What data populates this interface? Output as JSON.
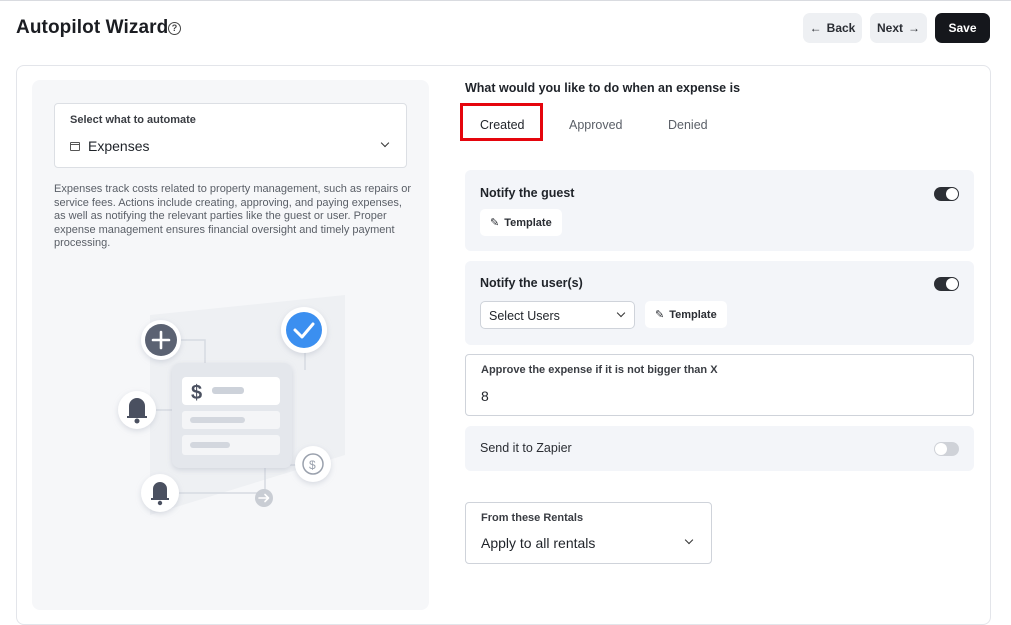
{
  "header": {
    "title": "Autopilot Wizard",
    "help_glyph": "?",
    "back_label": "Back",
    "next_label": "Next",
    "save_label": "Save"
  },
  "automate": {
    "label": "Select what to automate",
    "value": "Expenses",
    "description": "Expenses track costs related to property management, such as repairs or service fees. Actions include creating, approving, and paying expenses, as well as notifying the relevant parties like the guest or user. Proper expense management ensures financial oversight and timely payment processing."
  },
  "question": "What would you like to do when an expense is",
  "tabs": [
    {
      "label": "Created",
      "active": true
    },
    {
      "label": "Approved",
      "active": false
    },
    {
      "label": "Denied",
      "active": false
    }
  ],
  "notify_guest": {
    "title": "Notify the guest",
    "enabled": true,
    "template_label": "Template"
  },
  "notify_users": {
    "title": "Notify the user(s)",
    "enabled": true,
    "select_value": "Select Users",
    "template_label": "Template"
  },
  "approve": {
    "label": "Approve the expense if it is not bigger than X",
    "value": "8"
  },
  "zapier": {
    "label": "Send it to Zapier",
    "enabled": false
  },
  "rentals": {
    "label": "From these Rentals",
    "value": "Apply to all rentals"
  },
  "illustration": {
    "currency_glyph": "$",
    "coin_glyph": "$"
  },
  "colors": {
    "save_bg": "#15171c",
    "highlight": "#e5050d",
    "check_blue": "#3b8ff0",
    "panel_bg": "#f3f5f9"
  }
}
